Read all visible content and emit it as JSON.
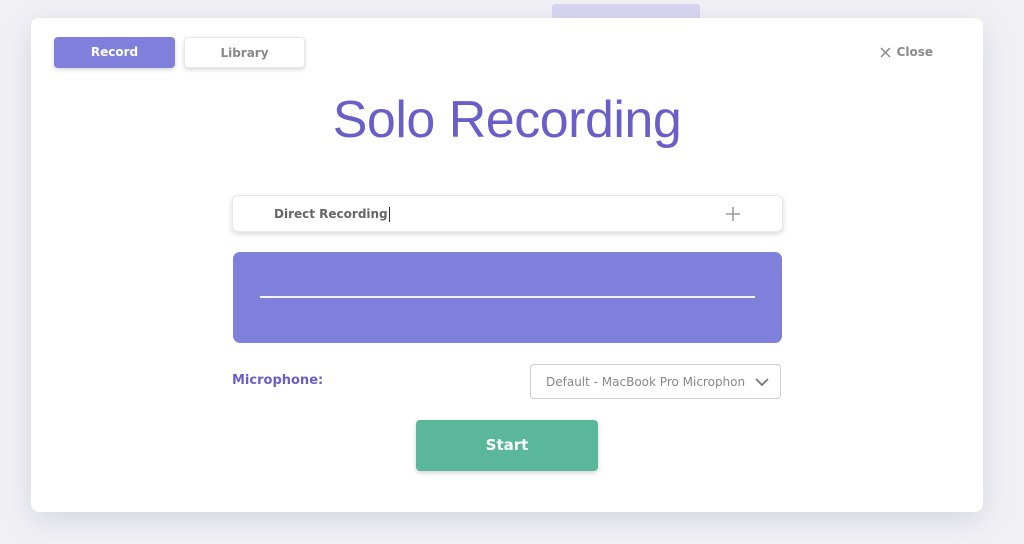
{
  "tabs": {
    "record_label": "Record",
    "library_label": "Library",
    "active": "Record"
  },
  "close": {
    "label": "Close",
    "icon": "close-x-icon"
  },
  "title": "Solo Recording",
  "recording_name": {
    "value": "Direct Recording",
    "add_icon": "plus-icon"
  },
  "microphone": {
    "label": "Microphone:",
    "selected": "Default - MacBook Pro Microphone (Built-in)",
    "dropdown_icon": "chevron-down-icon"
  },
  "start_label": "Start",
  "colors": {
    "accent": "#7f80dc",
    "title": "#6a5fc9",
    "start": "#5bb79a"
  }
}
